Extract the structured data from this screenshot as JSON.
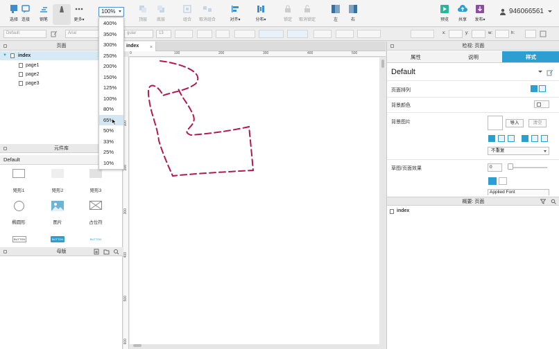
{
  "toolbar": {
    "buttons": [
      {
        "label": "选择",
        "icon": "select-icon"
      },
      {
        "label": "连接",
        "icon": "connect-icon"
      },
      {
        "label": "钢笔",
        "icon": "pen-icon"
      },
      {
        "label": "更多▾",
        "icon": "more-icon"
      }
    ],
    "zoom_value": "100%",
    "disabled_buttons": [
      {
        "label": "顶层",
        "icon": "bring-to-front-icon"
      },
      {
        "label": "底层",
        "icon": "send-to-back-icon"
      },
      {
        "label": "组合",
        "icon": "group-icon"
      },
      {
        "label": "取消组合",
        "icon": "ungroup-icon"
      }
    ],
    "align_label": "对齐▾",
    "distribute_label": "分布▾",
    "lock_label": "锁定",
    "unlock_label": "取消锁定",
    "left_label": "左",
    "right_label": "右",
    "preview_label": "预览",
    "share_label": "共享",
    "publish_label": "发布▾",
    "user_id": "946066561",
    "accent_color": "#2ba0d0"
  },
  "formatbar": {
    "style_select": "Default",
    "font_family": "Arial",
    "font_weight": "gular",
    "font_size": "13",
    "x_label": "x:",
    "y_label": "y:",
    "w_label": "w:",
    "h_label": "h:"
  },
  "pages_panel": {
    "title": "页面",
    "items": [
      {
        "label": "index",
        "selected": true
      },
      {
        "label": "page1"
      },
      {
        "label": "page2"
      },
      {
        "label": "page3"
      }
    ]
  },
  "library_panel": {
    "title": "元件库",
    "selected_library": "Default",
    "widgets": [
      {
        "label": "矩形1"
      },
      {
        "label": "矩形2"
      },
      {
        "label": "矩形3"
      },
      {
        "label": "椭圆形"
      },
      {
        "label": "图片"
      },
      {
        "label": "占位符"
      }
    ],
    "button_labels": [
      "BUTTON",
      "BUTTON",
      "BUTTON"
    ]
  },
  "masters_panel": {
    "title": "母版"
  },
  "canvas": {
    "tab_label": "index",
    "ruler_top": [
      "0",
      "100",
      "200",
      "300",
      "400",
      "500"
    ],
    "ruler_left": [
      "100",
      "200",
      "300",
      "400",
      "500",
      "600"
    ],
    "stroke_color": "#b01850"
  },
  "zoom_menu": {
    "options": [
      "400%",
      "350%",
      "300%",
      "250%",
      "200%",
      "150%",
      "125%",
      "100%",
      "80%",
      "65%",
      "50%",
      "33%",
      "25%",
      "10%"
    ],
    "hovered": "65%"
  },
  "inspector": {
    "title": "检视: 页面",
    "tabs": [
      {
        "label": "属性"
      },
      {
        "label": "说明"
      },
      {
        "label": "样式",
        "active": true
      }
    ],
    "style_name": "Default",
    "page_align_label": "页面排列",
    "bg_color_label": "背景颜色",
    "bg_image_label": "背景图片",
    "import_label": "导入",
    "clear_label": "清空",
    "repeat_value": "不重复",
    "sketch_label": "草图/页面效果",
    "sketch_value": "0",
    "applied_font": "Applied Font"
  },
  "outline_panel": {
    "title": "概要: 页面",
    "item": "index"
  }
}
